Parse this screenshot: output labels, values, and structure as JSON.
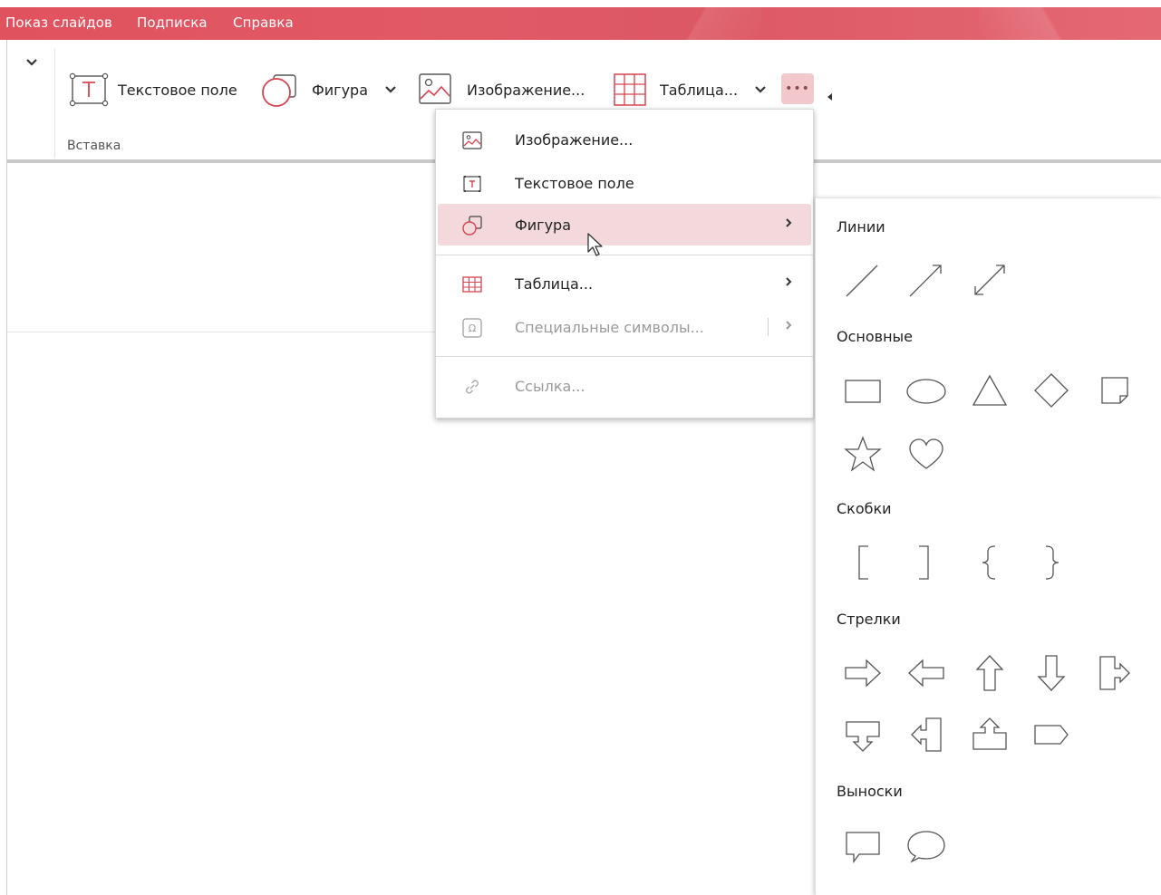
{
  "menubar": {
    "items": [
      "Показ слайдов",
      "Подписка",
      "Справка"
    ],
    "accent": "#e0525e"
  },
  "ribbon": {
    "group_label": "Вставка",
    "buttons": {
      "text_field": "Текстовое поле",
      "shape": "Фигура",
      "image": "Изображение...",
      "table": "Таблица...",
      "more": "•••"
    }
  },
  "dropdown": {
    "items": [
      {
        "label": "Изображение...",
        "icon": "image-icon"
      },
      {
        "label": "Текстовое поле",
        "icon": "text-box-icon"
      },
      {
        "label": "Фигура",
        "icon": "shape-icon",
        "highlighted": true,
        "submenu": true
      },
      {
        "label": "Таблица...",
        "icon": "table-icon",
        "submenu": true
      },
      {
        "label": "Специальные символы...",
        "icon": "omega-icon",
        "disabled": true,
        "submenu": true
      },
      {
        "label": "Ссылка...",
        "icon": "link-icon",
        "disabled": true
      }
    ],
    "highlight_color": "#f3d9dc"
  },
  "shapes_panel": {
    "sections": {
      "lines": "Линии",
      "basic": "Основные",
      "brackets": "Скобки",
      "arrows": "Стрелки",
      "callouts": "Выноски"
    },
    "lines": [
      "line-icon",
      "arrow-line-icon",
      "double-arrow-line-icon"
    ],
    "basic": [
      "rectangle-icon",
      "ellipse-icon",
      "triangle-icon",
      "diamond-icon",
      "folded-corner-icon",
      "star-icon",
      "heart-icon"
    ],
    "brackets": [
      "left-bracket-icon",
      "right-bracket-icon",
      "left-brace-icon",
      "right-brace-icon"
    ],
    "arrows": [
      "right-arrow-icon",
      "left-arrow-icon",
      "up-arrow-icon",
      "down-arrow-icon",
      "right-arrow-callout-icon",
      "down-arrow-callout-icon",
      "left-arrow-callout-icon",
      "up-arrow-callout-icon",
      "pentagon-arrow-icon"
    ],
    "callouts": [
      "rectangular-callout-icon",
      "oval-callout-icon"
    ]
  }
}
